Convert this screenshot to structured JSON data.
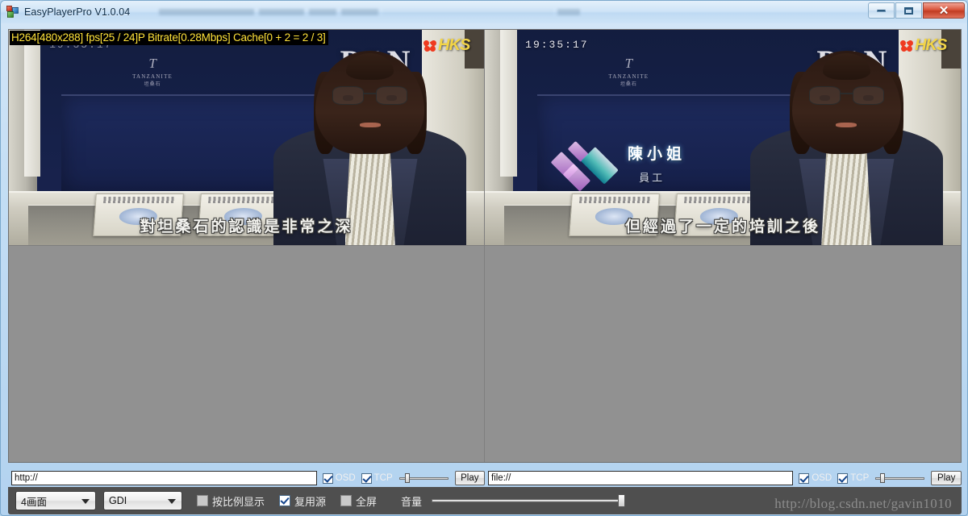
{
  "window": {
    "title": "EasyPlayerPro V1.0.04",
    "icon": "app-blocks-icon",
    "buttons": {
      "minimize": "minimize-icon",
      "maximize": "maximize-icon",
      "close": "close-icon"
    }
  },
  "panels": [
    {
      "id": "top-left",
      "osd_stats": "H264[480x288] fps[25 / 24]P Bitrate[0.28Mbps] Cache[0 + 2 = 2 / 3]",
      "timecode": "19:35:17",
      "channel_logo": "HKS",
      "backdrop_text": "PIN",
      "brand_mark": "T",
      "brand_name": "TANZANITE",
      "brand_sub": "坦桑石",
      "subtitle": "對坦桑石的認識是非常之深",
      "nameplate": null
    },
    {
      "id": "top-right",
      "osd_stats": null,
      "timecode": "19:35:17",
      "channel_logo": "HKS",
      "backdrop_text": "PIN",
      "brand_mark": "T",
      "brand_name": "TANZANITE",
      "brand_sub": "坦桑石",
      "subtitle": "但經過了一定的培訓之後",
      "nameplate": {
        "name": "陳小姐",
        "role": "員工"
      }
    },
    {
      "id": "bottom-left",
      "osd_stats": null,
      "empty": true
    },
    {
      "id": "bottom-right",
      "osd_stats": null,
      "empty": true
    }
  ],
  "controls": {
    "left": {
      "url_value": "http://",
      "url_placeholder": "http://",
      "osd_label": "OSD",
      "osd_checked": true,
      "tcp_label": "TCP",
      "tcp_checked": true,
      "play_label": "Play",
      "buffer_percent": 12
    },
    "right": {
      "url_value": "file://",
      "url_placeholder": "file://",
      "osd_label": "OSD",
      "osd_checked": true,
      "tcp_label": "TCP",
      "tcp_checked": true,
      "play_label": "Play",
      "buffer_percent": 10
    }
  },
  "toolbar": {
    "layout_select": "4画面",
    "render_select": "GDI",
    "aspect_label": "按比例显示",
    "aspect_checked": false,
    "reuse_label": "复用源",
    "reuse_checked": true,
    "fullscreen_label": "全屏",
    "fullscreen_checked": false,
    "volume_label": "音量",
    "volume_percent": 100
  },
  "watermark": "http://blog.csdn.net/gavin1010",
  "colors": {
    "osd_text": "#ffe23a",
    "panel_bg": "#919191",
    "control_bg": "#4f4f4f",
    "titlebar": "#cfe4f7",
    "close_button": "#c03b22"
  }
}
